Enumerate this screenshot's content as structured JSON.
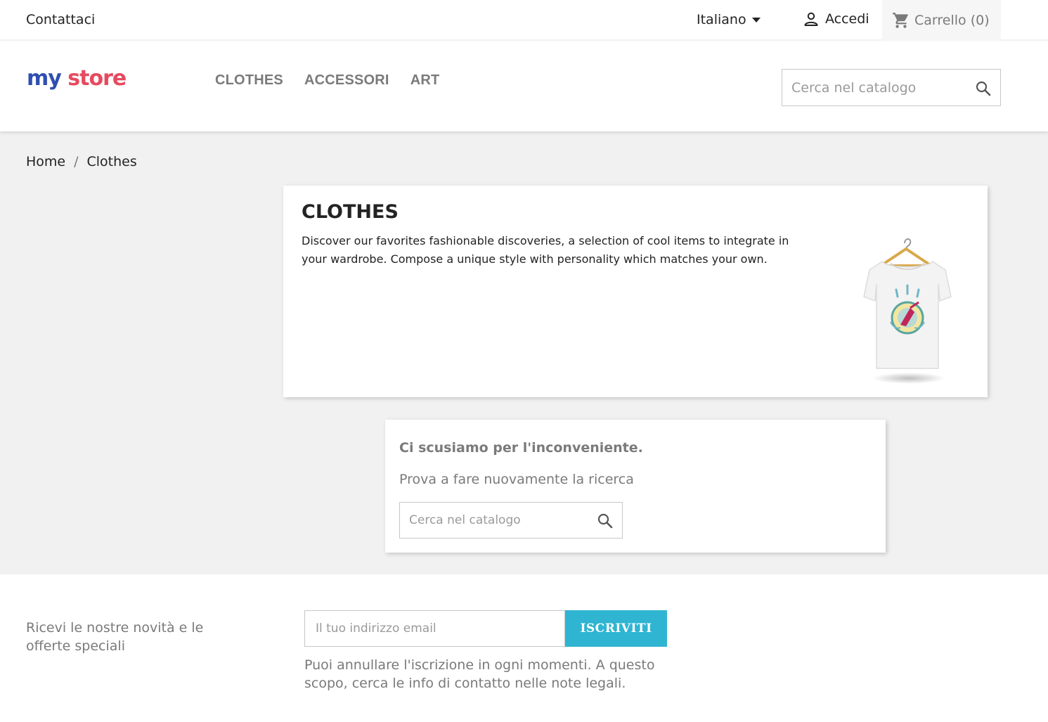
{
  "topbar": {
    "contact": "Contattaci",
    "language": "Italiano",
    "login": "Accedi",
    "cart": "Carrello (0)"
  },
  "header": {
    "logo_part1": "my",
    "logo_part2": "store",
    "nav": [
      "CLOTHES",
      "ACCESSORI",
      "ART"
    ],
    "search_placeholder": "Cerca nel catalogo"
  },
  "breadcrumb": {
    "items": [
      "Home",
      "Clothes"
    ],
    "separator": "/"
  },
  "category": {
    "title": "CLOTHES",
    "description": "Discover our favorites fashionable discoveries, a selection of cool items to integrate in your wardrobe. Compose a unique style with personality which matches your own."
  },
  "empty": {
    "title": "Ci scusiamo per l'inconveniente.",
    "subtitle": "Prova a fare nuovamente la ricerca",
    "search_placeholder": "Cerca nel catalogo"
  },
  "footer": {
    "newsletter_text": "Ricevi le nostre novità e le offerte speciali",
    "email_placeholder": "Il tuo indirizzo email",
    "subscribe": "ISCRIVITI",
    "note": "Puoi annullare l'iscrizione in ogni momenti. A questo scopo, cerca le info di contatto nelle note legali."
  },
  "colors": {
    "accent": "#2fb5d2",
    "muted": "#7a7a7a",
    "background": "#f1f1f1"
  }
}
